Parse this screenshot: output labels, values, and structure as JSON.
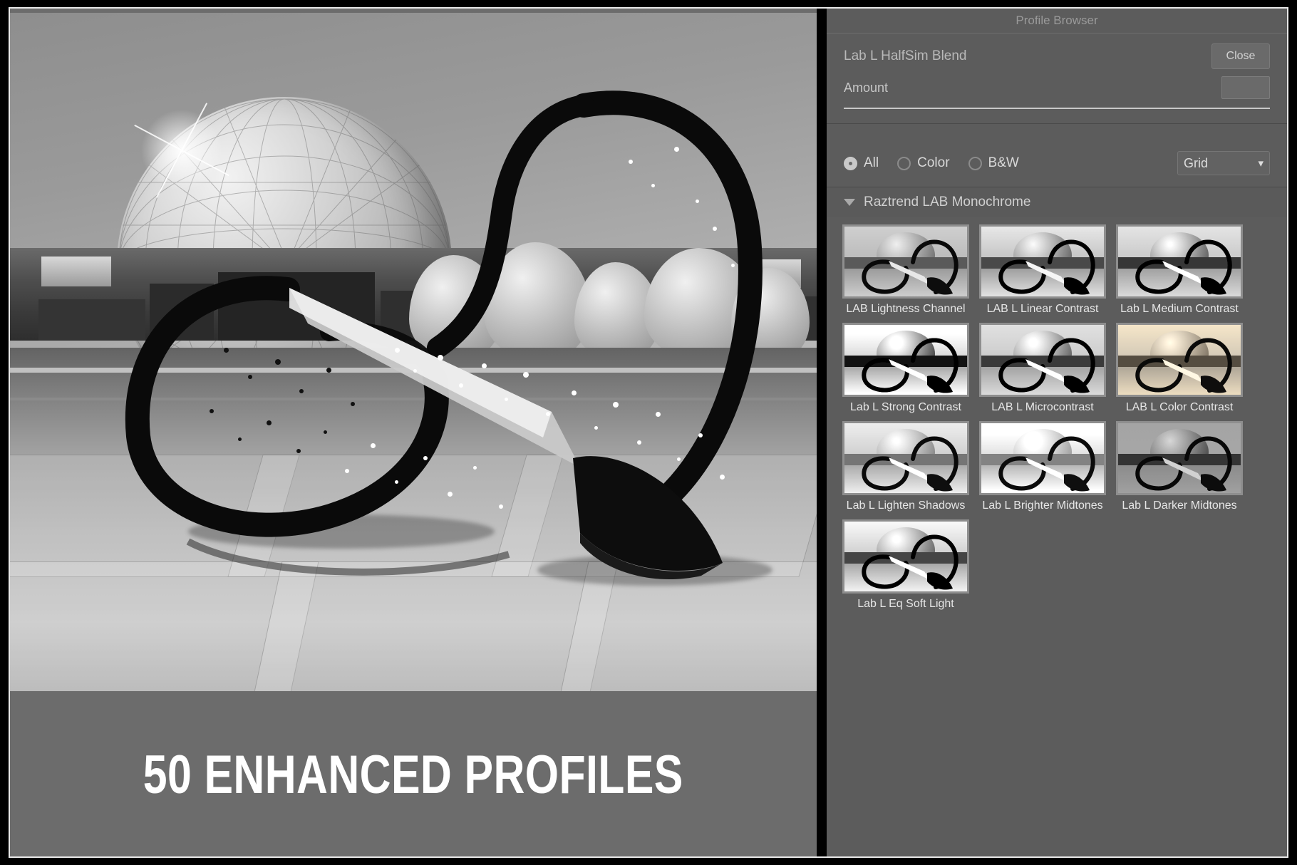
{
  "banner": {
    "text": "50 ENHANCED PROFILES"
  },
  "panel": {
    "title": "Profile Browser",
    "profile_name": "Lab L HalfSim Blend",
    "close_label": "Close",
    "amount_label": "Amount",
    "amount_value": "",
    "filters": [
      {
        "label": "All",
        "selected": true
      },
      {
        "label": "Color",
        "selected": false
      },
      {
        "label": "B&W",
        "selected": false
      }
    ],
    "view_mode": "Grid",
    "view_chevron": "chevron-down-icon",
    "group": {
      "title": "Raztrend LAB Monochrome",
      "expanded": true,
      "profiles": [
        {
          "label": "LAB Lightness Channel",
          "tone": "neutral"
        },
        {
          "label": "LAB L Linear Contrast",
          "tone": "linear"
        },
        {
          "label": "Lab L Medium Contrast",
          "tone": "medium"
        },
        {
          "label": "Lab L Strong Contrast",
          "tone": "strong"
        },
        {
          "label": "LAB L Microcontrast",
          "tone": "micro"
        },
        {
          "label": "LAB L Color Contrast",
          "tone": "warm"
        },
        {
          "label": "Lab L Lighten Shadows",
          "tone": "lighten"
        },
        {
          "label": "Lab L Brighter Midtones",
          "tone": "bright"
        },
        {
          "label": "Lab L Darker Midtones",
          "tone": "dark"
        },
        {
          "label": "Lab L Eq Soft Light",
          "tone": "soft"
        }
      ]
    }
  },
  "colors": {
    "panel_bg": "#5c5c5c",
    "stage_bg": "#6c6c6c",
    "text_primary": "#e6e6e6",
    "text_muted": "#9a9a9a",
    "thumb_border": "#8e8e8e",
    "frame": "#000000",
    "rule": "#e8e8e8"
  },
  "photo": {
    "subject": "monochrome photograph of a looping black tube fountain sculpture in front of a geodesic mirrored sphere",
    "mode": "black-and-white"
  }
}
